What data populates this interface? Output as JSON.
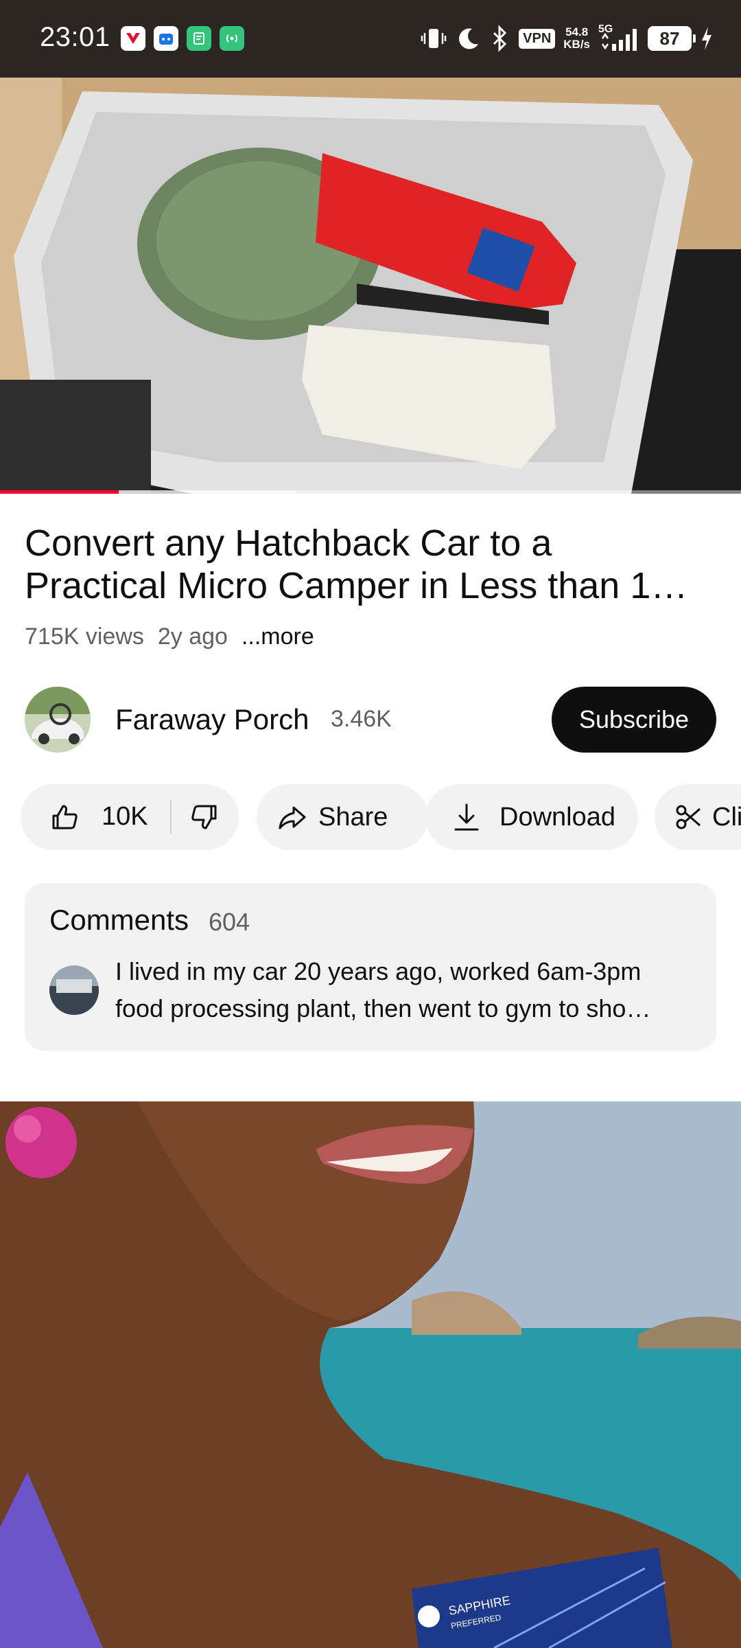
{
  "status_bar": {
    "time": "23:01",
    "vpn": "VPN",
    "speed_value": "54.8",
    "speed_unit": "KB/s",
    "network": "5G",
    "battery": "87"
  },
  "video": {
    "progress_fraction": 0.16,
    "buffer_fraction": 0.4
  },
  "title": {
    "line1": "Convert any Hatchback Car to a",
    "line2": "Practical Micro Camper in Less than 1…"
  },
  "meta": {
    "views": "715K views",
    "age": "2y ago",
    "more": "...more"
  },
  "channel": {
    "name": "Faraway Porch",
    "subscribers": "3.46K",
    "subscribe_label": "Subscribe"
  },
  "actions": {
    "like_count": "10K",
    "share_label": "Share",
    "download_label": "Download",
    "clip_label": "Cli"
  },
  "comments": {
    "label": "Comments",
    "count": "604",
    "top_comment_line1": "I lived in my car 20 years ago, worked 6am-3pm",
    "top_comment_line2": "food processing plant, then went to gym to sho…"
  },
  "ad": {
    "card_brand": "SAPPHIRE",
    "card_tier": "PREFERRED"
  },
  "colors": {
    "accent_red": "#ff0033",
    "subscribe_bg": "#0f0f0f",
    "pill_bg": "#f2f2f2"
  }
}
